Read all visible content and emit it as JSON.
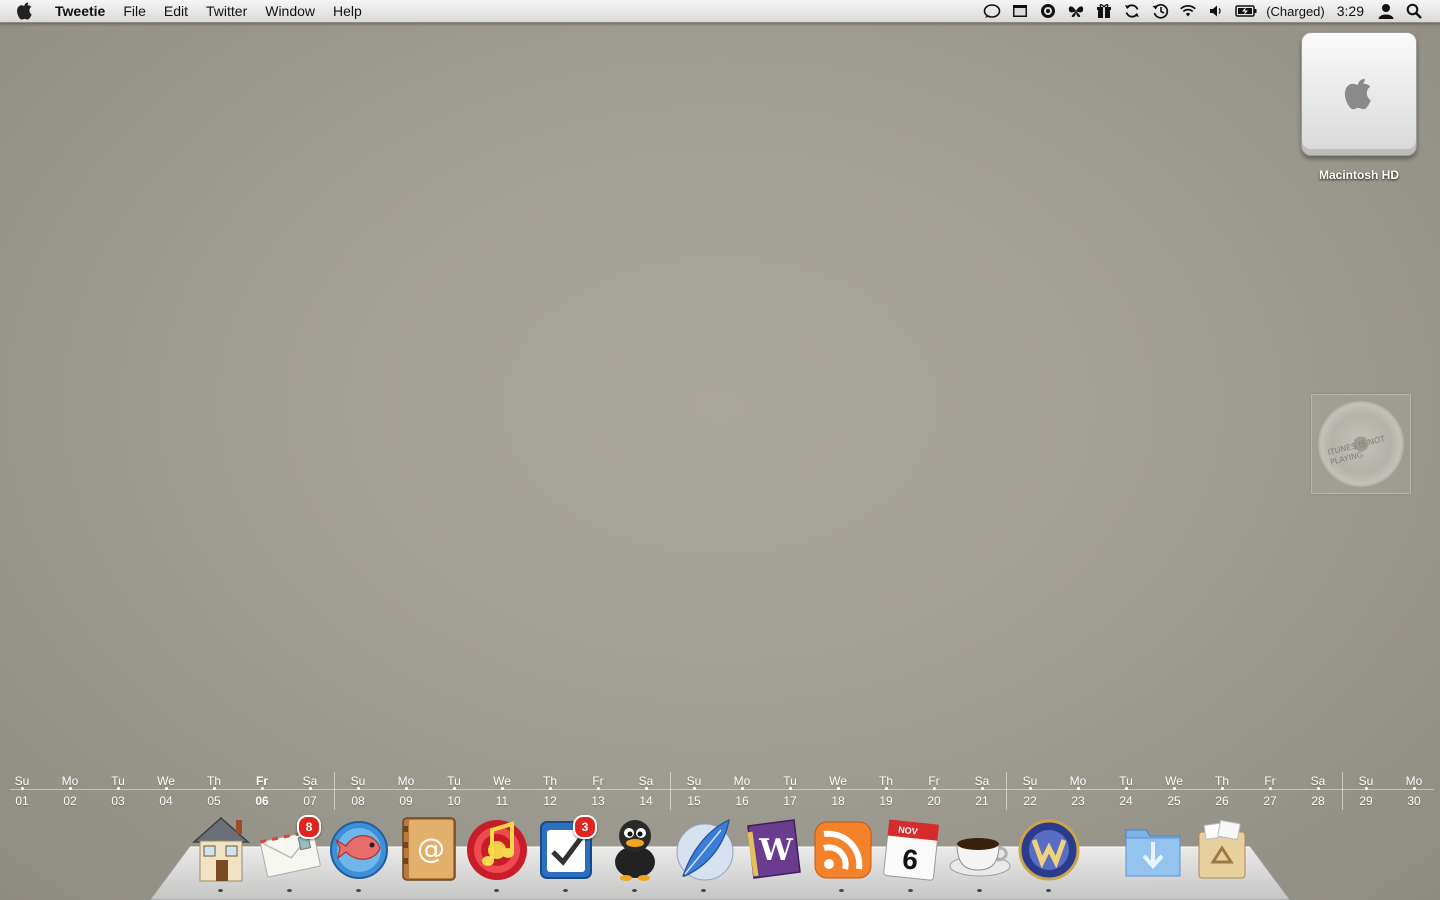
{
  "menubar": {
    "app_name": "Tweetie",
    "menus": [
      "File",
      "Edit",
      "Twitter",
      "Window",
      "Help"
    ],
    "status_icons": [
      "chat-bubble-icon",
      "window-icon",
      "growl-icon",
      "butterfly-icon",
      "gift-icon",
      "sync-icon",
      "time-machine-icon",
      "wifi-icon",
      "volume-icon",
      "battery-icon"
    ],
    "battery_status": "(Charged)",
    "clock": "3:29"
  },
  "desktop": {
    "hd_label": "Macintosh HD",
    "itunes_widget_text": "iTunes is not playing"
  },
  "calendar": {
    "days": [
      {
        "name": "Su",
        "date": "01"
      },
      {
        "name": "Mo",
        "date": "02"
      },
      {
        "name": "Tu",
        "date": "03"
      },
      {
        "name": "We",
        "date": "04"
      },
      {
        "name": "Th",
        "date": "05"
      },
      {
        "name": "Fr",
        "date": "06"
      },
      {
        "name": "Sa",
        "date": "07"
      },
      {
        "name": "Su",
        "date": "08"
      },
      {
        "name": "Mo",
        "date": "09"
      },
      {
        "name": "Tu",
        "date": "10"
      },
      {
        "name": "We",
        "date": "11"
      },
      {
        "name": "Th",
        "date": "12"
      },
      {
        "name": "Fr",
        "date": "13"
      },
      {
        "name": "Sa",
        "date": "14"
      },
      {
        "name": "Su",
        "date": "15"
      },
      {
        "name": "Mo",
        "date": "16"
      },
      {
        "name": "Tu",
        "date": "17"
      },
      {
        "name": "We",
        "date": "18"
      },
      {
        "name": "Th",
        "date": "19"
      },
      {
        "name": "Fr",
        "date": "20"
      },
      {
        "name": "Sa",
        "date": "21"
      },
      {
        "name": "Su",
        "date": "22"
      },
      {
        "name": "Mo",
        "date": "23"
      },
      {
        "name": "Tu",
        "date": "24"
      },
      {
        "name": "We",
        "date": "25"
      },
      {
        "name": "Th",
        "date": "26"
      },
      {
        "name": "Fr",
        "date": "27"
      },
      {
        "name": "Sa",
        "date": "28"
      },
      {
        "name": "Su",
        "date": "29"
      },
      {
        "name": "Mo",
        "date": "30"
      }
    ],
    "today": "06"
  },
  "dock": {
    "items": [
      {
        "icon": "home-icon",
        "running": true
      },
      {
        "icon": "mail-icon",
        "badge": "8",
        "running": true
      },
      {
        "icon": "fish-browser-icon",
        "running": true
      },
      {
        "icon": "address-book-icon",
        "running": false
      },
      {
        "icon": "itunes-icon",
        "running": true
      },
      {
        "icon": "task-checkbox-icon",
        "badge": "3",
        "running": true
      },
      {
        "icon": "adium-duck-icon",
        "running": true
      },
      {
        "icon": "feather-icon",
        "running": true
      },
      {
        "icon": "textmate-w-icon",
        "running": false
      },
      {
        "icon": "rss-icon",
        "running": true
      },
      {
        "icon": "ical-icon",
        "running": true
      },
      {
        "icon": "coffee-cup-icon",
        "running": true
      },
      {
        "icon": "world-of-warcraft-icon",
        "running": true
      },
      {
        "icon": "downloads-folder-icon",
        "running": false
      },
      {
        "icon": "trash-icon",
        "running": false
      }
    ],
    "ical_month": "NOV",
    "ical_day": "6"
  }
}
